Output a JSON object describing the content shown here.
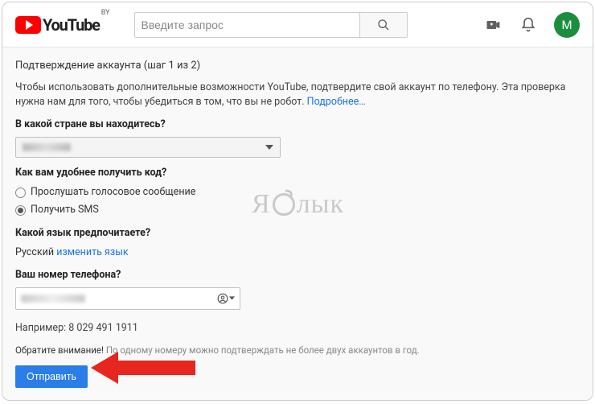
{
  "header": {
    "logo_text": "YouTube",
    "country_code": "BY",
    "search_placeholder": "Введите запрос",
    "avatar_letter": "M"
  },
  "page": {
    "step_title": "Подтверждение аккаунта (шаг 1 из 2)",
    "description_1": "Чтобы использовать дополнительные возможности YouTube, подтвердите свой аккаунт по телефону. Эта проверка нужна нам для того, чтобы убедиться в том, что вы не робот. ",
    "learn_more": "Подробнее…",
    "country_label": "В какой стране вы находитесь?",
    "code_label": "Как вам удобнее получить код?",
    "radio_voice": "Прослушать голосовое сообщение",
    "radio_sms": "Получить SMS",
    "selected_radio": "sms",
    "lang_label": "Какой язык предпочитаете?",
    "lang_value": "Русский",
    "lang_change": "изменить язык",
    "phone_label": "Ваш номер телефона?",
    "example": "Например: 8 029 491 1911",
    "notice_attention": "Обратите внимание!",
    "notice_rest": " По одному номеру можно подтверждать не более двух аккаунтов в год.",
    "submit": "Отправить"
  },
  "watermark": {
    "left": "Я",
    "right": "лык"
  }
}
